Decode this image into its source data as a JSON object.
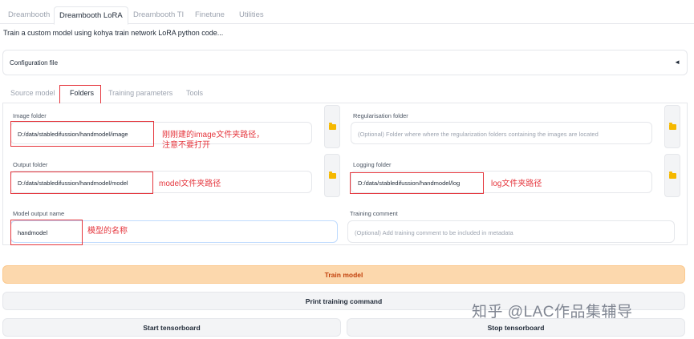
{
  "top_tabs": [
    "Dreambooth",
    "Dreambooth LoRA",
    "Dreambooth TI",
    "Finetune",
    "Utilities"
  ],
  "description": "Train a custom model using kohya train network LoRA python code...",
  "config": {
    "label": "Configuration file",
    "arrow": "◄"
  },
  "sub_tabs": [
    "Source model",
    "Folders",
    "Training parameters",
    "Tools"
  ],
  "fields": {
    "image_folder": {
      "label": "Image folder",
      "value": "D:/data/stabledifussion/handmodel/image"
    },
    "regularisation_folder": {
      "label": "Regularisation folder",
      "placeholder": "(Optional) Folder where where the regularization folders containing the images are located"
    },
    "output_folder": {
      "label": "Output folder",
      "value": "D:/data/stabledifussion/handmodel/model"
    },
    "logging_folder": {
      "label": "Logging folder",
      "value": "D:/data/stabledifussion/handmodel/log"
    },
    "model_output_name": {
      "label": "Model output name",
      "value": "handmodel"
    },
    "training_comment": {
      "label": "Training comment",
      "placeholder": "(Optional) Add training comment to be included in metadata"
    }
  },
  "annotations": {
    "image": "刚刚建的image文件夹路径，\n注意不要打开",
    "model": "model文件夹路径",
    "log": "log文件夹路径",
    "name": "模型的名称"
  },
  "buttons": {
    "train": "Train model",
    "print": "Print training command",
    "start_tb": "Start tensorboard",
    "stop_tb": "Stop tensorboard"
  },
  "watermark": "知乎 @LAC作品集辅导",
  "colors": {
    "annotation": "#e5363d",
    "primary_button": "#fcd8ad",
    "folder_icon": "#f5b800"
  }
}
